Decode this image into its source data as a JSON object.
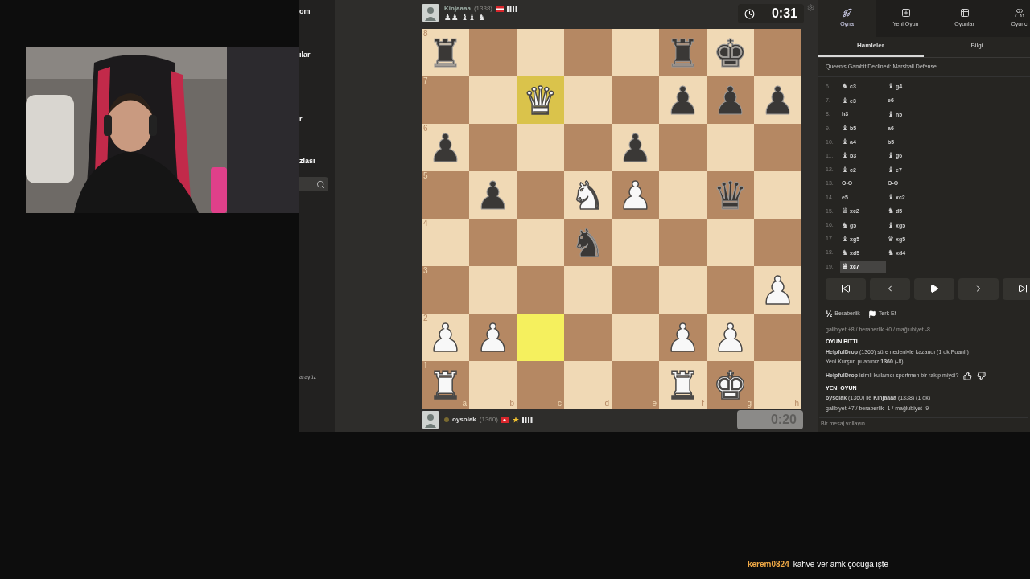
{
  "sidebar": {
    "items": [
      "om",
      "ılar",
      "r",
      "zlası"
    ],
    "footer": "arayüz"
  },
  "top_player": {
    "name": "Kinjaaaa",
    "rating": "(1338)",
    "captured": "♟♟ ♝♝ ♞",
    "clock": "0:31",
    "clock_active": true
  },
  "bottom_player": {
    "name": "oysolak",
    "rating": "(1360)",
    "clock": "0:20",
    "clock_active": false
  },
  "board": {
    "files": [
      "a",
      "b",
      "c",
      "d",
      "e",
      "f",
      "g",
      "h"
    ],
    "ranks": [
      {
        "label": "8",
        "squares": [
          {
            "piece": "♜",
            "kind": "black",
            "highlighted": false
          },
          {
            "highlighted": false
          },
          {
            "highlighted": false
          },
          {
            "highlighted": false
          },
          {
            "highlighted": false
          },
          {
            "piece": "♜",
            "kind": "black",
            "highlighted": false
          },
          {
            "piece": "♚",
            "kind": "black",
            "highlighted": false
          },
          {
            "highlighted": false
          }
        ]
      },
      {
        "label": "7",
        "squares": [
          {
            "highlighted": false
          },
          {
            "highlighted": false
          },
          {
            "piece": "♛",
            "kind": "white",
            "highlighted": true
          },
          {
            "highlighted": false
          },
          {
            "highlighted": false
          },
          {
            "piece": "♟",
            "kind": "black",
            "highlighted": false
          },
          {
            "piece": "♟",
            "kind": "black",
            "highlighted": false
          },
          {
            "piece": "♟",
            "kind": "black",
            "highlighted": false
          }
        ]
      },
      {
        "label": "6",
        "squares": [
          {
            "piece": "♟",
            "kind": "black",
            "highlighted": false
          },
          {
            "highlighted": false
          },
          {
            "highlighted": false
          },
          {
            "highlighted": false
          },
          {
            "piece": "♟",
            "kind": "black",
            "highlighted": false
          },
          {
            "highlighted": false
          },
          {
            "highlighted": false
          },
          {
            "highlighted": false
          }
        ]
      },
      {
        "label": "5",
        "squares": [
          {
            "highlighted": false
          },
          {
            "piece": "♟",
            "kind": "black",
            "highlighted": false
          },
          {
            "highlighted": false
          },
          {
            "piece": "♞",
            "kind": "white",
            "highlighted": false
          },
          {
            "piece": "♟",
            "kind": "white",
            "highlighted": false
          },
          {
            "highlighted": false
          },
          {
            "piece": "♛",
            "kind": "black",
            "highlighted": false
          },
          {
            "highlighted": false
          }
        ]
      },
      {
        "label": "4",
        "squares": [
          {
            "highlighted": false
          },
          {
            "highlighted": false
          },
          {
            "highlighted": false
          },
          {
            "piece": "♞",
            "kind": "black",
            "highlighted": false
          },
          {
            "highlighted": false
          },
          {
            "highlighted": false
          },
          {
            "highlighted": false
          },
          {
            "highlighted": false
          }
        ]
      },
      {
        "label": "3",
        "squares": [
          {
            "highlighted": false
          },
          {
            "highlighted": false
          },
          {
            "highlighted": false
          },
          {
            "highlighted": false
          },
          {
            "highlighted": false
          },
          {
            "highlighted": false
          },
          {
            "highlighted": false
          },
          {
            "piece": "♟",
            "kind": "white",
            "highlighted": false
          }
        ]
      },
      {
        "label": "2",
        "squares": [
          {
            "piece": "♟",
            "kind": "white",
            "highlighted": false
          },
          {
            "piece": "♟",
            "kind": "white",
            "highlighted": false
          },
          {
            "highlighted": true
          },
          {
            "highlighted": false
          },
          {
            "highlighted": false
          },
          {
            "piece": "♟",
            "kind": "white",
            "highlighted": false
          },
          {
            "piece": "♟",
            "kind": "white",
            "highlighted": false
          },
          {
            "highlighted": false
          }
        ]
      },
      {
        "label": "1",
        "squares": [
          {
            "piece": "♜",
            "kind": "white",
            "highlighted": false
          },
          {
            "highlighted": false
          },
          {
            "highlighted": false
          },
          {
            "highlighted": false
          },
          {
            "highlighted": false
          },
          {
            "piece": "♜",
            "kind": "white",
            "highlighted": false
          },
          {
            "piece": "♚",
            "kind": "white",
            "highlighted": false
          },
          {
            "highlighted": false
          }
        ]
      }
    ]
  },
  "nav": [
    {
      "label": "Oyna",
      "selected": true
    },
    {
      "label": "Yeni Oyun",
      "selected": false
    },
    {
      "label": "Oyunlar",
      "selected": false
    },
    {
      "label": "Oyunc",
      "selected": false
    }
  ],
  "tabs": [
    {
      "label": "Hamleler",
      "selected": true
    },
    {
      "label": "Bilgi",
      "selected": false
    }
  ],
  "opening": "Queen's Gambit Declined: Marshall Defense",
  "moves": [
    {
      "number": "6.",
      "white": {
        "figure": "♞",
        "san": "c3",
        "selected": false
      },
      "black": {
        "figure": "♝",
        "san": "g4",
        "selected": false
      }
    },
    {
      "number": "7.",
      "white": {
        "figure": "♝",
        "san": "e3",
        "selected": false
      },
      "black": {
        "san": "e6",
        "selected": false
      }
    },
    {
      "number": "8.",
      "white": {
        "san": "h3",
        "selected": false
      },
      "black": {
        "figure": "♝",
        "san": "h5",
        "selected": false
      }
    },
    {
      "number": "9.",
      "white": {
        "figure": "♝",
        "san": "b5",
        "selected": false
      },
      "black": {
        "san": "a6",
        "selected": false
      }
    },
    {
      "number": "10.",
      "white": {
        "figure": "♝",
        "san": "a4",
        "selected": false
      },
      "black": {
        "san": "b5",
        "selected": false
      }
    },
    {
      "number": "11.",
      "white": {
        "figure": "♝",
        "san": "b3",
        "selected": false
      },
      "black": {
        "figure": "♝",
        "san": "g6",
        "selected": false
      }
    },
    {
      "number": "12.",
      "white": {
        "figure": "♝",
        "san": "c2",
        "selected": false
      },
      "black": {
        "figure": "♝",
        "san": "e7",
        "selected": false
      }
    },
    {
      "number": "13.",
      "white": {
        "san": "O-O",
        "selected": false
      },
      "black": {
        "san": "O-O",
        "selected": false
      }
    },
    {
      "number": "14.",
      "white": {
        "san": "e5",
        "selected": false
      },
      "black": {
        "figure": "♝",
        "san": "xc2",
        "selected": false
      }
    },
    {
      "number": "15.",
      "white": {
        "figure": "♛",
        "san": "xc2",
        "selected": false
      },
      "black": {
        "figure": "♞",
        "san": "d5",
        "selected": false
      }
    },
    {
      "number": "16.",
      "white": {
        "figure": "♞",
        "san": "g5",
        "selected": false
      },
      "black": {
        "figure": "♝",
        "san": "xg5",
        "selected": false
      }
    },
    {
      "number": "17.",
      "white": {
        "figure": "♝",
        "san": "xg5",
        "selected": false
      },
      "black": {
        "figure": "♛",
        "san": "xg5",
        "selected": false
      }
    },
    {
      "number": "18.",
      "white": {
        "figure": "♞",
        "san": "xd5",
        "selected": false
      },
      "black": {
        "figure": "♞",
        "san": "xd4",
        "selected": false
      }
    },
    {
      "number": "19.",
      "white": {
        "figure": "♛",
        "san": "xc7",
        "selected": true
      }
    }
  ],
  "controls": [
    {
      "kind": "first"
    },
    {
      "kind": "prev"
    },
    {
      "kind": "play"
    },
    {
      "kind": "next"
    },
    {
      "kind": "last"
    }
  ],
  "actions": [
    {
      "kind": "draw",
      "glyph": "½",
      "label": "Beraberlik"
    },
    {
      "kind": "resign",
      "label": "Terk Et"
    }
  ],
  "log": [
    {
      "kind": "muted",
      "text": "galibiyet +8 / beraberlik +0 / mağlubiyet -8"
    },
    {
      "kind": "heading",
      "text": "OYUN BİTTİ"
    },
    {
      "kind": "line",
      "text": "**HelpfulDrop** (1365) süre nedeniyle kazandı (1 dk Puanlı)"
    },
    {
      "kind": "line",
      "text": "Yeni Kurşun puanınız **1360** (-8)."
    },
    {
      "kind": "feedback",
      "text": "**HelpfulDrop** isimli kullanıcı sportmen bir rakip miydi?"
    },
    {
      "kind": "heading",
      "text": "YENİ OYUN"
    },
    {
      "kind": "line",
      "text": "**oysolak** (1360) ile **Kinjaaaa** (1338) (1 dk)"
    },
    {
      "kind": "line",
      "text": "galibiyet +7 / beraberlik -1 / mağlubiyet -9"
    }
  ],
  "chat_input": {
    "placeholder": "Bir mesaj yollayın..."
  },
  "stream_chat": {
    "user": "kerem0824",
    "message": "kahve ver amk çocuğa işte"
  }
}
